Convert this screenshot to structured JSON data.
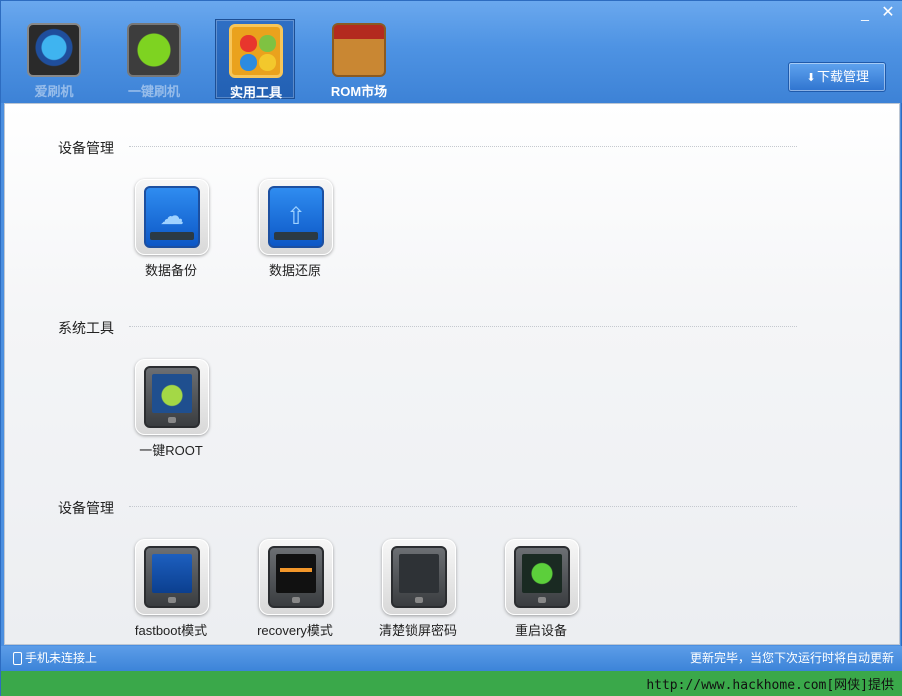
{
  "window": {
    "minimize_glyph": "_",
    "close_glyph": "✕"
  },
  "nav": {
    "tabs": [
      {
        "label": "爱刷机",
        "icon": "flash-machine-icon",
        "active": false
      },
      {
        "label": "一键刷机",
        "icon": "refresh-arrows-icon",
        "active": false
      },
      {
        "label": "实用工具",
        "icon": "tools-grid-icon",
        "active": true
      },
      {
        "label": "ROM市场",
        "icon": "market-stall-icon",
        "active": false
      }
    ],
    "manage_button": {
      "label": "下载管理",
      "icon": "download-arrow-icon"
    }
  },
  "sections": [
    {
      "title": "设备管理",
      "items": [
        {
          "label": "数据备份",
          "icon": "cloud-drive-icon"
        },
        {
          "label": "数据还原",
          "icon": "restore-drive-icon"
        }
      ]
    },
    {
      "title": "系统工具",
      "items": [
        {
          "label": "一键ROOT",
          "icon": "android-phone-icon"
        }
      ]
    },
    {
      "title": "设备管理",
      "items": [
        {
          "label": "fastboot模式",
          "icon": "fastboot-phone-icon"
        },
        {
          "label": "recovery模式",
          "icon": "recovery-phone-icon"
        },
        {
          "label": "清楚锁屏密码",
          "icon": "lock-pattern-phone-icon"
        },
        {
          "label": "重启设备",
          "icon": "power-phone-icon"
        }
      ]
    }
  ],
  "status": {
    "left": "手机未连接上",
    "right": "更新完毕，当您下次运行时将自动更新"
  },
  "watermark": "http://www.hackhome.com[网侠]提供",
  "colors": {
    "title_bar": "#4e93e3",
    "status_bar": "#4a8fde",
    "watermark_bar": "#3aa84a"
  }
}
